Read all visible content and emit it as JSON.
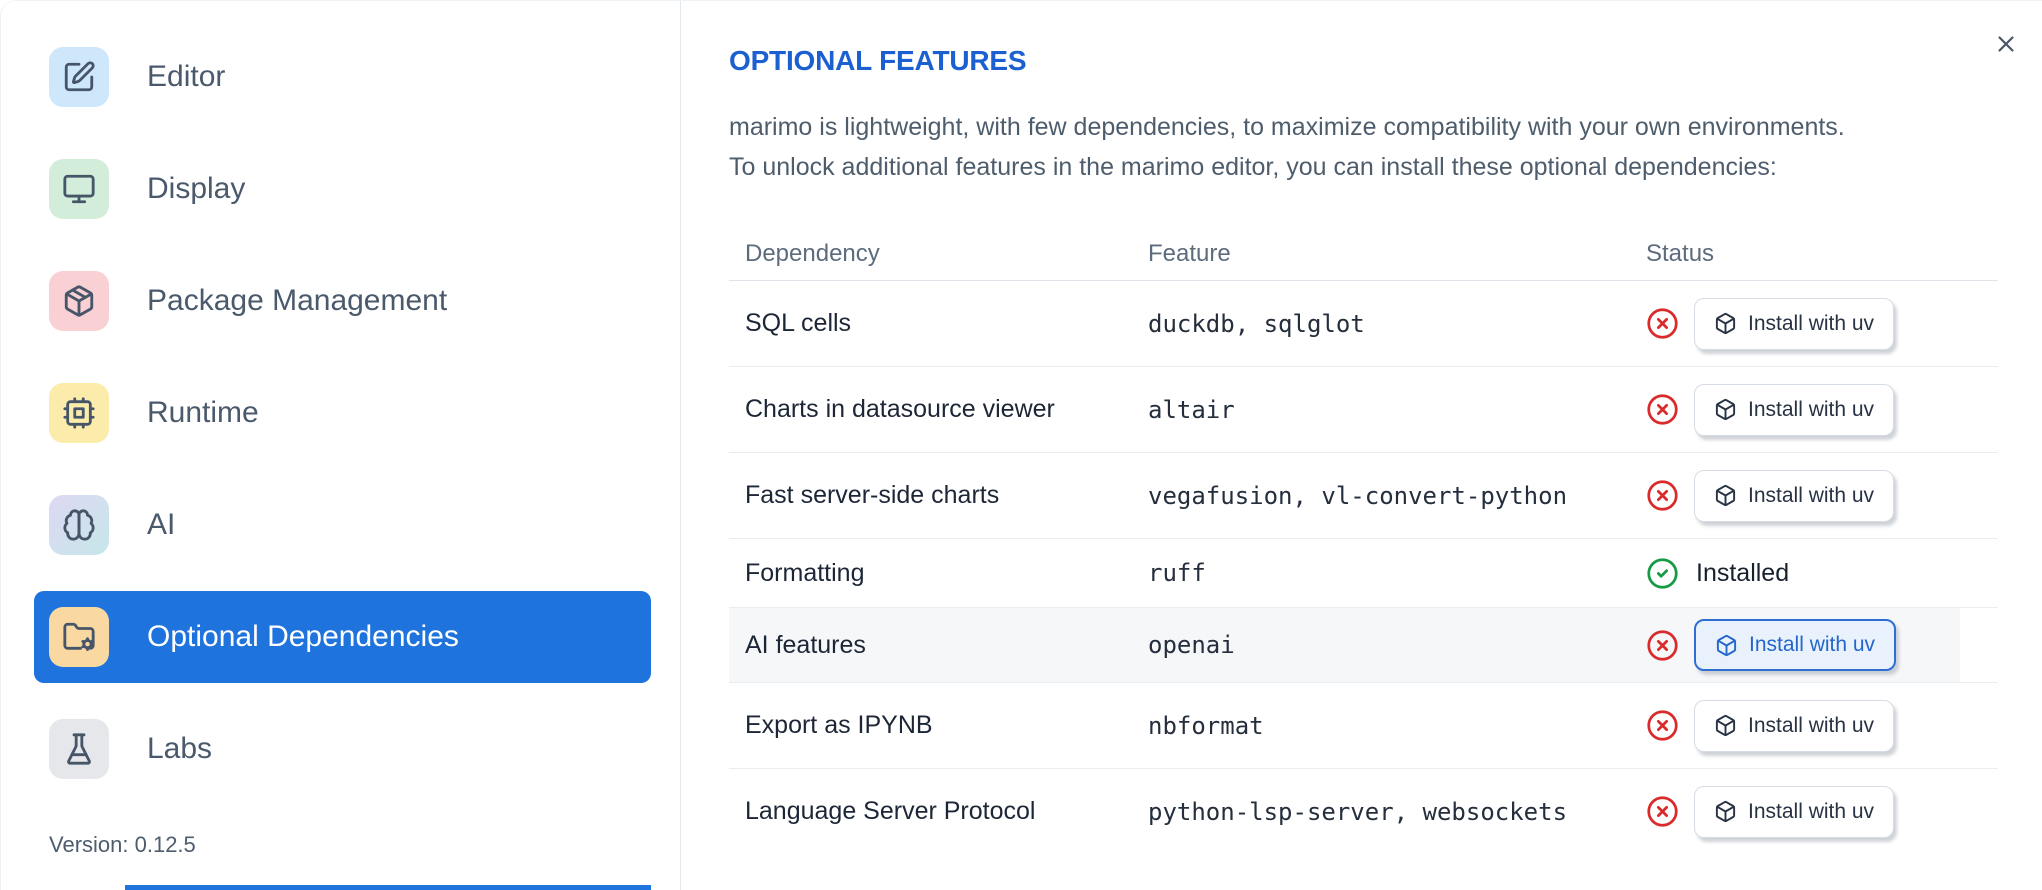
{
  "sidebar": {
    "items": [
      {
        "label": "Editor",
        "icon": "square-pen-icon",
        "icon_bg": "#cfe7fb",
        "selected": false
      },
      {
        "label": "Display",
        "icon": "monitor-icon",
        "icon_bg": "#d2eeda",
        "selected": false
      },
      {
        "label": "Package Management",
        "icon": "package-icon",
        "icon_bg": "#f9d0d4",
        "selected": false
      },
      {
        "label": "Runtime",
        "icon": "cpu-icon",
        "icon_bg": "#fcecab",
        "selected": false
      },
      {
        "label": "AI",
        "icon": "brain-icon",
        "icon_bg": "linear-gradient(135deg,#ded8f3,#c6e7ea)",
        "selected": false
      },
      {
        "label": "Optional Dependencies",
        "icon": "folder-cog-icon",
        "icon_bg": "#fad8a2",
        "selected": true
      },
      {
        "label": "Labs",
        "icon": "flask-icon",
        "icon_bg": "#e5e7ea",
        "selected": false
      }
    ],
    "version_label": "Version: 0.12.5"
  },
  "panel": {
    "title": "OPTIONAL FEATURES",
    "description_line1": "marimo is lightweight, with few dependencies, to maximize compatibility with your own environments.",
    "description_line2": "To unlock additional features in the marimo editor, you can install these optional dependencies:",
    "table": {
      "columns": [
        "Dependency",
        "Feature",
        "Status"
      ],
      "install_button_label": "Install with uv",
      "installed_label": "Installed",
      "rows": [
        {
          "dependency": "SQL cells",
          "feature": "duckdb, sqlglot",
          "status": "not_installed",
          "highlighted": false
        },
        {
          "dependency": "Charts in datasource viewer",
          "feature": "altair",
          "status": "not_installed",
          "highlighted": false
        },
        {
          "dependency": "Fast server-side charts",
          "feature": "vegafusion, vl-convert-python",
          "status": "not_installed",
          "highlighted": false
        },
        {
          "dependency": "Formatting",
          "feature": "ruff",
          "status": "installed",
          "highlighted": false
        },
        {
          "dependency": "AI features",
          "feature": "openai",
          "status": "not_installed",
          "highlighted": true
        },
        {
          "dependency": "Export as IPYNB",
          "feature": "nbformat",
          "status": "not_installed",
          "highlighted": false
        },
        {
          "dependency": "Language Server Protocol",
          "feature": "python-lsp-server, websockets",
          "status": "not_installed",
          "highlighted": false
        }
      ]
    }
  },
  "icons": {
    "close": "close-icon",
    "status_not_installed": "circle-x-icon",
    "status_installed": "circle-check-icon",
    "install_button": "box-icon"
  },
  "colors": {
    "selection_blue": "#1f73dc",
    "title_blue": "#1b5fd0",
    "button_highlight_blue": "#2f6fd4",
    "status_red": "#d92b2b",
    "status_green": "#169a46"
  }
}
